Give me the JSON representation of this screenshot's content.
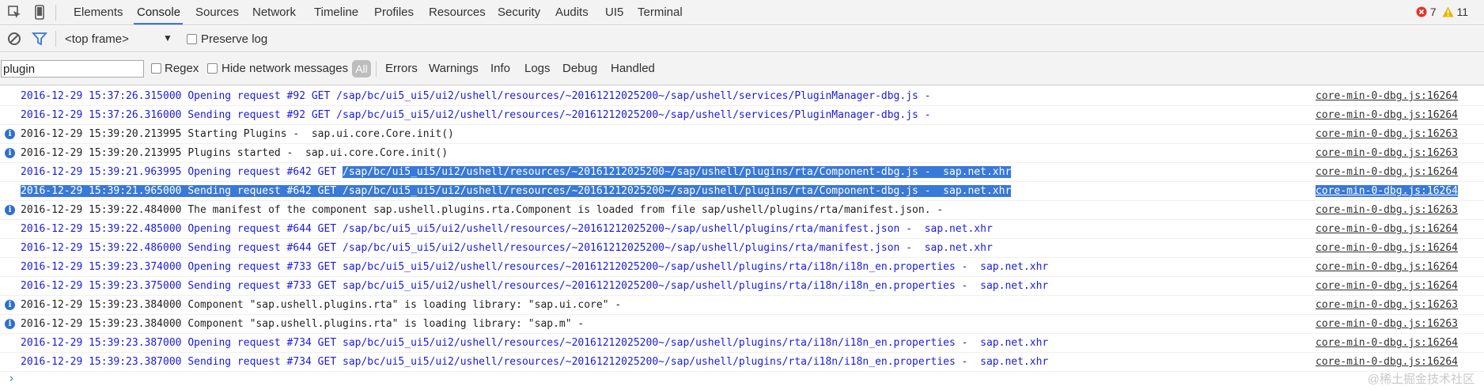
{
  "toolbar": {
    "tabs": [
      "Elements",
      "Console",
      "Sources",
      "Network",
      "Timeline",
      "Profiles",
      "Resources",
      "Security",
      "Audits",
      "UI5",
      "Terminal"
    ],
    "active_tab": "Console",
    "error_count": "7",
    "warning_count": "11",
    "inspect_icon": "inspect-element-icon",
    "device_icon": "device-mode-icon"
  },
  "context_bar": {
    "clear_icon": "clear-console-icon",
    "filter_icon": "filter-icon",
    "frame_select": "<top frame>",
    "preserve_log_label": "Preserve log"
  },
  "filter_bar": {
    "filter_value": "plugin",
    "regex_label": "Regex",
    "hide_network_label": "Hide network messages",
    "levels": [
      "All",
      "Errors",
      "Warnings",
      "Info",
      "Logs",
      "Debug",
      "Handled"
    ],
    "active_level": "All"
  },
  "log": {
    "rows": [
      {
        "type": "blue",
        "icon": "",
        "msg": "2016-12-29 15:37:26.315000 Opening request #92 GET /sap/bc/ui5_ui5/ui2/ushell/resources/~20161212025200~/sap/ushell/services/PluginManager-dbg.js -",
        "src": "core-min-0-dbg.js:16264"
      },
      {
        "type": "blue",
        "icon": "",
        "msg": "2016-12-29 15:37:26.316000 Sending request #92 GET /sap/bc/ui5_ui5/ui2/ushell/resources/~20161212025200~/sap/ushell/services/PluginManager-dbg.js -",
        "src": "core-min-0-dbg.js:16264"
      },
      {
        "type": "black",
        "icon": "info",
        "msg": "2016-12-29 15:39:20.213995 Starting Plugins -  sap.ui.core.Core.init()",
        "src": "core-min-0-dbg.js:16263"
      },
      {
        "type": "black",
        "icon": "info",
        "msg": "2016-12-29 15:39:20.213995 Plugins started -  sap.ui.core.Core.init()",
        "src": "core-min-0-dbg.js:16263"
      },
      {
        "type": "blue",
        "icon": "",
        "msg": "2016-12-29 15:39:21.963995 Opening request #642 GET ",
        "msg_sel": "/sap/bc/ui5_ui5/ui2/ushell/resources/~20161212025200~/sap/ushell/plugins/rta/Component-dbg.js -  sap.net.xhr",
        "src": "core-min-0-dbg.js:16264"
      },
      {
        "type": "blue",
        "icon": "",
        "msg": "",
        "msg_sel": "2016-12-29 15:39:21.965000 Sending request #642 GET /sap/bc/ui5_ui5/ui2/ushell/resources/~20161212025200~/sap/ushell/plugins/rta/Component-dbg.js -  sap.net.xhr",
        "src": "core-min-0-dbg.js:16264",
        "src_sel": true
      },
      {
        "type": "black",
        "icon": "info",
        "msg": "2016-12-29 15:39:22.484000 The manifest of the component sap.ushell.plugins.rta.Component is loaded from file sap/ushell/plugins/rta/manifest.json. -",
        "src": "core-min-0-dbg.js:16263"
      },
      {
        "type": "blue",
        "icon": "",
        "msg": "2016-12-29 15:39:22.485000 Opening request #644 GET /sap/bc/ui5_ui5/ui2/ushell/resources/~20161212025200~/sap/ushell/plugins/rta/manifest.json -  sap.net.xhr",
        "src": "core-min-0-dbg.js:16264"
      },
      {
        "type": "blue",
        "icon": "",
        "msg": "2016-12-29 15:39:22.486000 Sending request #644 GET /sap/bc/ui5_ui5/ui2/ushell/resources/~20161212025200~/sap/ushell/plugins/rta/manifest.json -  sap.net.xhr",
        "src": "core-min-0-dbg.js:16264"
      },
      {
        "type": "blue",
        "icon": "",
        "msg": "2016-12-29 15:39:23.374000 Opening request #733 GET sap/bc/ui5_ui5/ui2/ushell/resources/~20161212025200~/sap/ushell/plugins/rta/i18n/i18n_en.properties -  sap.net.xhr",
        "src": "core-min-0-dbg.js:16264"
      },
      {
        "type": "blue",
        "icon": "",
        "msg": "2016-12-29 15:39:23.375000 Sending request #733 GET sap/bc/ui5_ui5/ui2/ushell/resources/~20161212025200~/sap/ushell/plugins/rta/i18n/i18n_en.properties -  sap.net.xhr",
        "src": "core-min-0-dbg.js:16264"
      },
      {
        "type": "black",
        "icon": "info",
        "msg": "2016-12-29 15:39:23.384000 Component \"sap.ushell.plugins.rta\" is loading library: \"sap.ui.core\" -",
        "src": "core-min-0-dbg.js:16263"
      },
      {
        "type": "black",
        "icon": "info",
        "msg": "2016-12-29 15:39:23.384000 Component \"sap.ushell.plugins.rta\" is loading library: \"sap.m\" -",
        "src": "core-min-0-dbg.js:16263"
      },
      {
        "type": "blue",
        "icon": "",
        "msg": "2016-12-29 15:39:23.387000 Opening request #734 GET sap/bc/ui5_ui5/ui2/ushell/resources/~20161212025200~/sap/ushell/plugins/rta/i18n/i18n_en.properties -  sap.net.xhr",
        "src": "core-min-0-dbg.js:16264"
      },
      {
        "type": "blue",
        "icon": "",
        "msg": "2016-12-29 15:39:23.387000 Sending request #734 GET sap/bc/ui5_ui5/ui2/ushell/resources/~20161212025200~/sap/ushell/plugins/rta/i18n/i18n_en.properties -  sap.net.xhr",
        "src": "core-min-0-dbg.js:16264"
      }
    ],
    "prompt": "›"
  },
  "watermark": "@稀土掘金技术社区",
  "colors": {
    "accent": "#3879d9",
    "blue_text": "#1a1ae6",
    "error": "#e0352b",
    "warning": "#e8b500"
  }
}
